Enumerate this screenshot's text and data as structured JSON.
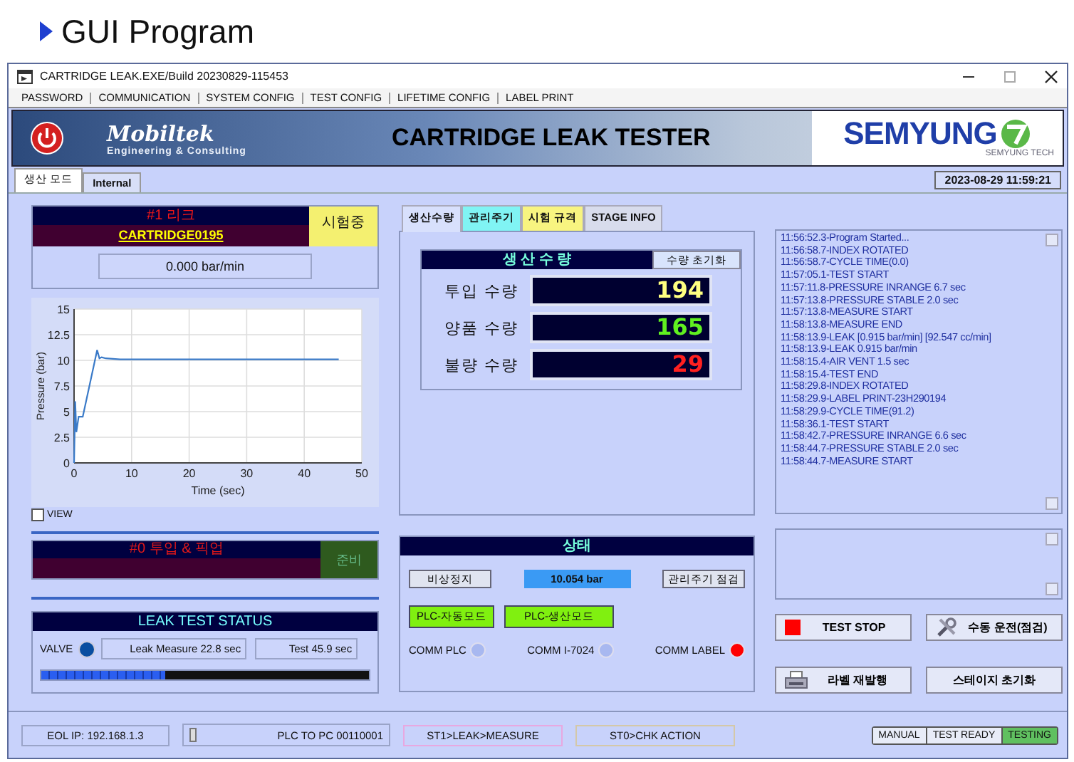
{
  "header": {
    "title": "GUI Program"
  },
  "window": {
    "title": "CARTRIDGE LEAK.EXE/Build 20230829-115453"
  },
  "menu": [
    "PASSWORD",
    "COMMUNICATION",
    "SYSTEM CONFIG",
    "TEST CONFIG",
    "LIFETIME CONFIG",
    "LABEL PRINT"
  ],
  "banner": {
    "company": "Mobiltek",
    "tagline": "Engineering & Consulting",
    "title": "CARTRIDGE LEAK TESTER",
    "partner": "SEMYUNG",
    "partner_sub": "SEMYUNG TECH"
  },
  "tabs": [
    {
      "label": "생산 모드",
      "selected": true
    },
    {
      "label": "Internal",
      "selected": false
    }
  ],
  "datetime": "2023-08-29 11:59:21",
  "leak_card": {
    "title": "#1 리크",
    "part": "CARTRIDGE0195",
    "state": "시험중",
    "reading": "0.000 bar/min"
  },
  "chart": {
    "chart_data": {
      "type": "line",
      "xlabel": "Time (sec)",
      "ylabel": "Pressure (bar)",
      "x": [
        0,
        0.2,
        0.4,
        0.8,
        1.5,
        4,
        4.4,
        4.8,
        5.5,
        8,
        46
      ],
      "grid": true,
      "series": [
        {
          "color": "#3a7ac8",
          "values": [
            0,
            6,
            3,
            4.5,
            4.5,
            11,
            10.2,
            10.3,
            10.2,
            10.1,
            10.1
          ]
        }
      ],
      "xlim": [
        0,
        50
      ],
      "ylim": [
        0,
        15
      ],
      "xticks": [
        0,
        10,
        20,
        30,
        40,
        50
      ],
      "yticks": [
        0,
        2.5,
        5,
        7.5,
        10,
        12.5,
        15
      ]
    }
  },
  "view_checkbox": {
    "label": "VIEW",
    "checked": false
  },
  "pickup_card": {
    "title": "#0 투입 & 픽업",
    "state": "준비"
  },
  "status_card": {
    "title": "LEAK TEST STATUS",
    "valve_label": "VALVE",
    "valve_on": true,
    "leak_measure": "Leak Measure 22.8 sec",
    "test": "Test 45.9 sec",
    "progress": {
      "level": 0.38
    }
  },
  "sub_tabs": [
    {
      "label": "생산수량",
      "selected": true,
      "color": "#d8e0fc"
    },
    {
      "label": "관리주기",
      "selected": false,
      "color": "#80f4f4"
    },
    {
      "label": "시험 규격",
      "selected": false,
      "color": "#f8f480"
    },
    {
      "label": "STAGE INFO",
      "selected": false,
      "color": "#d8dcec"
    }
  ],
  "production": {
    "title": "생 산 수 량",
    "reset_button": "수량 초기화",
    "counters": [
      {
        "label": "투입 수량",
        "value": "194",
        "kind": "input"
      },
      {
        "label": "양품 수량",
        "value": "165",
        "kind": "good"
      },
      {
        "label": "불량 수량",
        "value": "29",
        "kind": "bad"
      }
    ]
  },
  "state_panel": {
    "title": "상태",
    "stop_button": "비상정지",
    "pressure": "10.054 bar",
    "check_button": "관리주기 점검",
    "modes": [
      "PLC-자동모드",
      "PLC-생산모드"
    ],
    "comms": [
      {
        "label": "COMM PLC",
        "color": "#a8b8f0"
      },
      {
        "label": "COMM I-7024",
        "color": "#a8b8f0"
      },
      {
        "label": "COMM LABEL",
        "color": "#ff0000"
      }
    ]
  },
  "log": [
    "11:56:52.3-Program Started...",
    "11:56:58.7-INDEX ROTATED",
    "11:56:58.7-CYCLE TIME(0.0)",
    "11:57:05.1-TEST START",
    "11:57:11.8-PRESSURE INRANGE 6.7 sec",
    "11:57:13.8-PRESSURE STABLE 2.0 sec",
    "11:57:13.8-MEASURE START",
    "11:58:13.8-MEASURE END",
    "11:58:13.9-LEAK [0.915 bar/min] [92.547 cc/min]",
    "11:58:13.9-LEAK 0.915 bar/min",
    "11:58:15.4-AIR VENT 1.5 sec",
    "11:58:15.4-TEST END",
    "11:58:29.8-INDEX ROTATED",
    "11:58:29.9-LABEL PRINT-23H290194",
    "11:58:29.9-CYCLE TIME(91.2)",
    "11:58:36.1-TEST START",
    "11:58:42.7-PRESSURE INRANGE 6.6 sec",
    "11:58:44.7-PRESSURE STABLE 2.0 sec",
    "11:58:44.7-MEASURE START"
  ],
  "actions": [
    {
      "label": "TEST STOP",
      "kind": "stop"
    },
    {
      "label": "수동 운전(점검)",
      "kind": "tools"
    },
    {
      "label": "라벨 재발행",
      "kind": "printer"
    },
    {
      "label": "스테이지 초기화",
      "kind": "plain"
    }
  ],
  "status_bar": {
    "ip": "EOL IP: 192.168.1.3",
    "plc": "PLC TO PC 00110001",
    "station1": "ST1>LEAK>MEASURE",
    "station0": "ST0>CHK ACTION",
    "modes": [
      {
        "label": "MANUAL",
        "selected": false
      },
      {
        "label": "TEST READY",
        "selected": false
      },
      {
        "label": "TESTING",
        "selected": true
      }
    ]
  }
}
